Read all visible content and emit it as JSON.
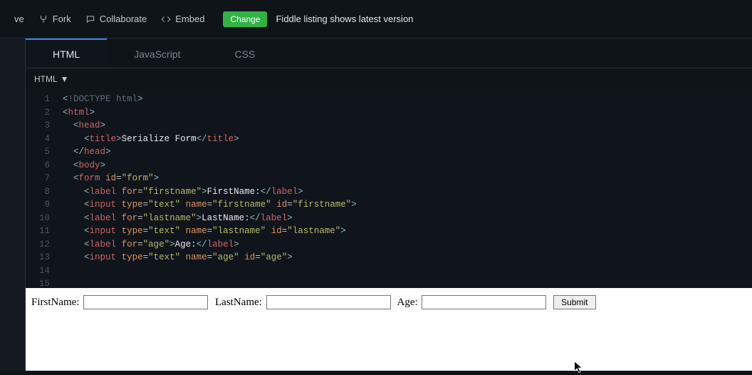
{
  "topbar": {
    "save_label": "ve",
    "fork_label": "Fork",
    "collaborate_label": "Collaborate",
    "embed_label": "Embed",
    "change_label": "Change",
    "listing_text": "Fiddle listing shows latest version"
  },
  "tabs": {
    "html": "HTML",
    "javascript": "JavaScript",
    "css": "CSS"
  },
  "lang_selector": "HTML",
  "code_title_text": "Serialize Form",
  "code_labels": {
    "firstname_label": "FirstName:",
    "lastname_label": "LastName:",
    "age_label": "Age:"
  },
  "code_attrs": {
    "id_form": "form",
    "for_firstname": "firstname",
    "for_lastname": "lastname",
    "for_age": "age",
    "type_text": "text",
    "name_firstname": "firstname",
    "id_firstname": "firstname",
    "name_lastname": "lastname",
    "id_lastname": "lastname",
    "name_age": "age",
    "id_age": "age"
  },
  "line_numbers": [
    "1",
    "2",
    "3",
    "4",
    "5",
    "6",
    "7",
    "8",
    "9",
    "10",
    "11",
    "12",
    "13",
    "14",
    "15"
  ],
  "preview": {
    "firstname_label": "FirstName:",
    "lastname_label": "LastName:",
    "age_label": "Age:",
    "submit_label": "Submit"
  }
}
